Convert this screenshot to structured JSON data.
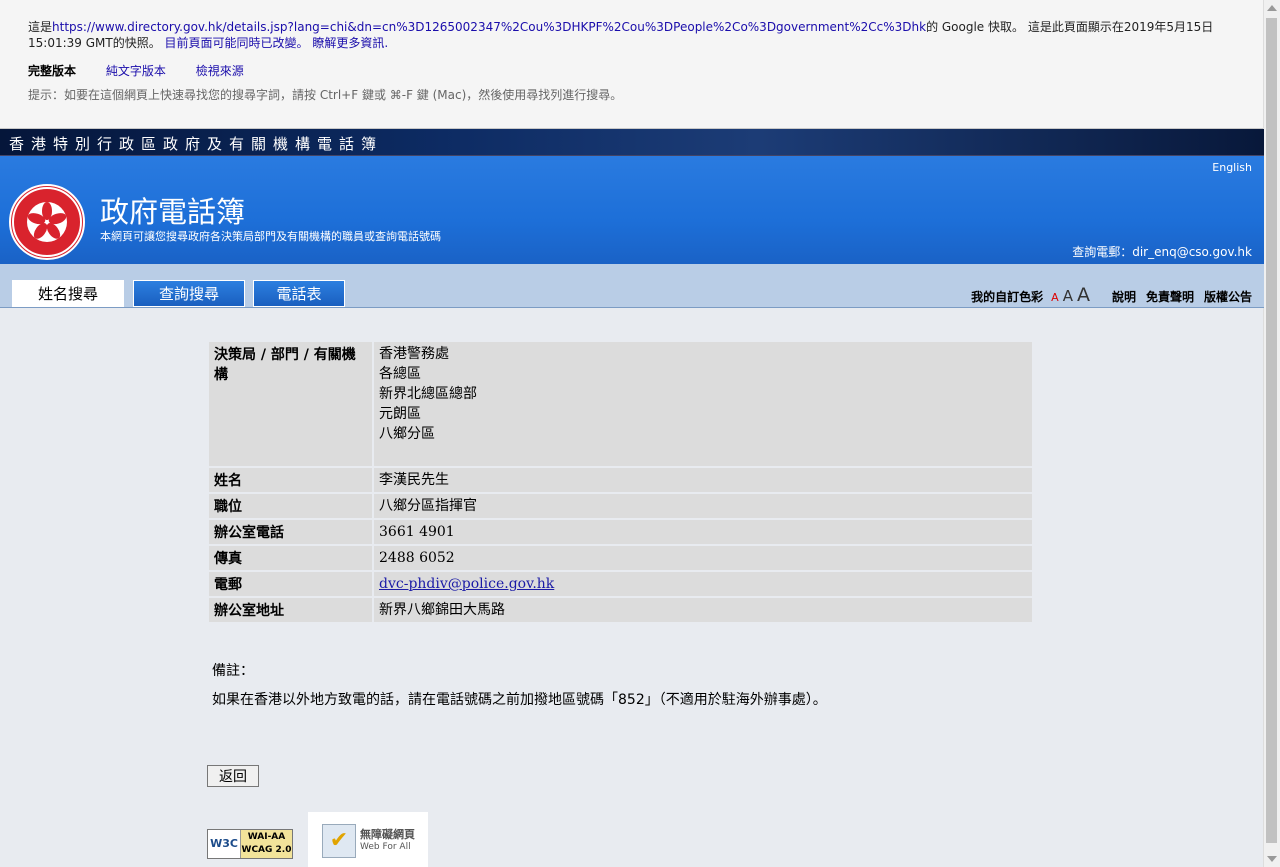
{
  "cache_banner": {
    "prefix": "這是",
    "cached_url": "https://www.directory.gov.hk/details.jsp?lang=chi&dn=cn%3D1265002347%2Cou%3DHKPF%2Cou%3DPeople%2Co%3Dgovernment%2Cc%3Dhk",
    "suffix": "的 Google 快取。 這是此頁面顯示在2019年5月15日 15:01:39 GMT的快照。",
    "changed_link": "目前頁面可能同時已改變。",
    "learn_more": "瞭解更多資訊.",
    "versions": {
      "full": "完整版本",
      "text_only": "純文字版本",
      "view_source": "檢視來源"
    },
    "hint": "提示：如要在這個網頁上快速尋找您的搜尋字詞，請按 Ctrl+F 鍵或 ⌘-F 鍵 (Mac)，然後使用尋找列進行搜尋。"
  },
  "header": {
    "org_name": "香港特別行政區政府及有關機構電話簿",
    "title": "政府電話簿",
    "subtitle": "本網頁可讓您搜尋政府各決策局部門及有關機構的職員或查詢電話號碼",
    "language_link": "English",
    "enquiry_email": "查詢電郵：dir_enq@cso.gov.hk"
  },
  "tabs": [
    {
      "label": "姓名搜尋",
      "active": true
    },
    {
      "label": "查詢搜尋",
      "active": false
    },
    {
      "label": "電話表",
      "active": false
    }
  ],
  "tools": {
    "custom_color": "我的自訂色彩",
    "font_small": "A",
    "font_medium": "A",
    "font_large": "A",
    "help": "說明",
    "disclaimer": "免責聲明",
    "copyright": "版權公告"
  },
  "details": {
    "department_label": "決策局 / 部門 / 有關機構",
    "department_lines": [
      "香港警務處",
      "各總區",
      "新界北總區總部",
      "元朗區",
      "八鄉分區"
    ],
    "name_label": "姓名",
    "name": "李漢民先生",
    "post_label": "職位",
    "post": "八鄉分區指揮官",
    "office_tel_label": "辦公室電話",
    "office_tel": "3661 4901",
    "fax_label": "傳真",
    "fax": "2488 6052",
    "email_label": "電郵",
    "email": "dvc-phdiv@police.gov.hk",
    "address_label": "辦公室地址",
    "address": "新界八鄉錦田大馬路"
  },
  "remarks": {
    "label": "備註：",
    "text": "如果在香港以外地方致電的話，請在電話號碼之前加撥地區號碼「852」（不適用於駐海外辦事處）。"
  },
  "back_button": "返回",
  "badges": {
    "w3c": "W3C",
    "wcag_line1": "WAI-AA",
    "wcag_line2": "WCAG 2.0",
    "webforall_title": "無障礙網頁",
    "webforall_sub": "Web For All"
  },
  "colors": {
    "header_blue": "#1d6fd8",
    "tab_bar": "#b9cde6",
    "strip_dark": "#0d2b63",
    "emblem_red": "#d9232d"
  }
}
